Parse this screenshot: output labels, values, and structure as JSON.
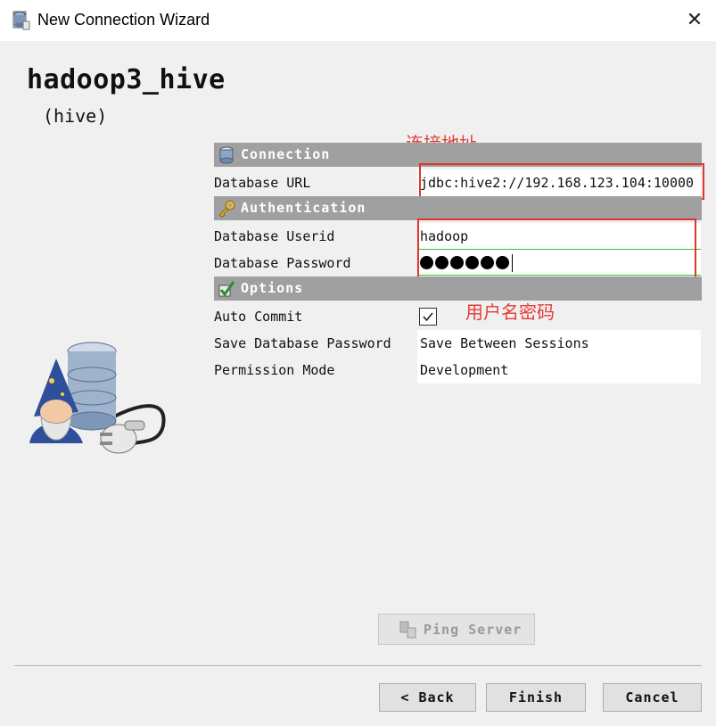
{
  "window": {
    "title": "New Connection Wizard",
    "close_glyph": "✕",
    "icon": "database-icon"
  },
  "header": {
    "connection_name": "hadoop3_hive",
    "driver_type": "(hive)"
  },
  "sections": {
    "connection": {
      "label": "Connection",
      "icon": "database-icon"
    },
    "authentication": {
      "label": "Authentication",
      "icon": "key-icon"
    },
    "options": {
      "label": "Options",
      "icon": "checkmark-icon"
    }
  },
  "fields": {
    "database_url": {
      "label": "Database URL",
      "value": "jdbc:hive2://192.168.123.104:10000"
    },
    "userid": {
      "label": "Database Userid",
      "value": "hadoop"
    },
    "password": {
      "label": "Database Password",
      "masked_length": 6
    },
    "auto_commit": {
      "label": "Auto Commit",
      "checked": true
    },
    "save_password": {
      "label": "Save Database Password",
      "value": "Save Between Sessions"
    },
    "permission_mode": {
      "label": "Permission Mode",
      "value": "Development"
    }
  },
  "annotations": {
    "url_note": "连接地址",
    "credentials_note": "用户名密码",
    "color": "#e33b36"
  },
  "buttons": {
    "ping": "Ping Server",
    "back": "< Back",
    "finish": "Finish",
    "cancel": "Cancel"
  },
  "colors": {
    "section_header": "#a0a0a0",
    "background": "#f0f0f0",
    "highlight_line": "#2ac52a"
  }
}
